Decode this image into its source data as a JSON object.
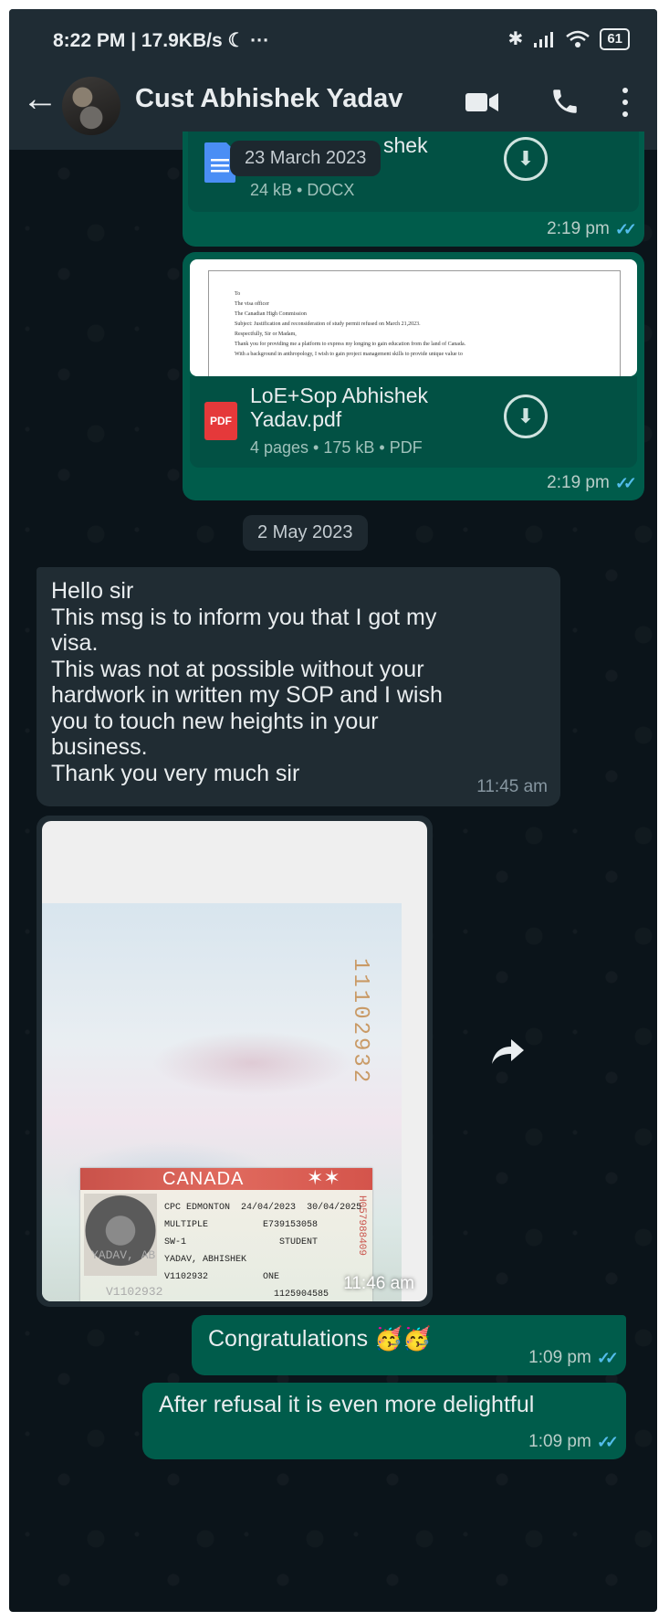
{
  "status_bar": {
    "time": "8:22 PM | 17.9KB/s ☾  ···",
    "battery": "61"
  },
  "header": {
    "contact_name": "Cust Abhishek Yadav"
  },
  "messages": {
    "docx": {
      "name_partial": "shek",
      "info": "24 kB • DOCX",
      "time": "2:19 pm",
      "date_overlay": "23 March 2023"
    },
    "pdf": {
      "preview_lines": [
        "To",
        "The visa officer",
        "The Canadian High Commission",
        "Subject: Justification and reconsideration of study permit refused on March 21,2023.",
        "Respectfully, Sir or Madam,",
        "Thank you for providing me a platform to express my longing to gain education from the land of Canada.",
        "With a background in anthropology, I wish to gain project management skills to provide unique value to"
      ],
      "name": "LoE+Sop Abhishek Yadav.pdf",
      "info": "4 pages • 175 kB • PDF",
      "time": "2:19 pm",
      "badge": "PDF"
    },
    "date_chip": "2 May 2023",
    "incoming_text": {
      "lines": [
        "Hello sir",
        "This msg is to inform you that I got my",
        "visa.",
        "This was not at possible without your",
        "hardwork in written my SOP and I wish",
        "you to touch new heights in your",
        "business.",
        "Thank you very much sir"
      ],
      "time": "11:45 am"
    },
    "incoming_image": {
      "time": "11:46 am",
      "visa": {
        "country": "CANADA",
        "office": "CPC EDMONTON",
        "date_from": "24/04/2023",
        "date_to": "30/04/2025",
        "entries": "MULTIPLE",
        "code": "SW-1",
        "number": "E739153058",
        "category": "STUDENT",
        "name": "YADAV, ABHISHEK",
        "passport": "V1102932",
        "count": "ONE",
        "uci": "1125904585",
        "side_number": "H057988409",
        "vertical_number": "11102932",
        "under_name": "YADAV, AB",
        "under_passport": "V1102932"
      }
    },
    "congrats": {
      "text": "Congratulations",
      "emoji": "🥳🥳",
      "time": "1:09 pm"
    },
    "after_refusal": {
      "text": "After refusal it is even more delightful",
      "time": "1:09 pm"
    }
  }
}
